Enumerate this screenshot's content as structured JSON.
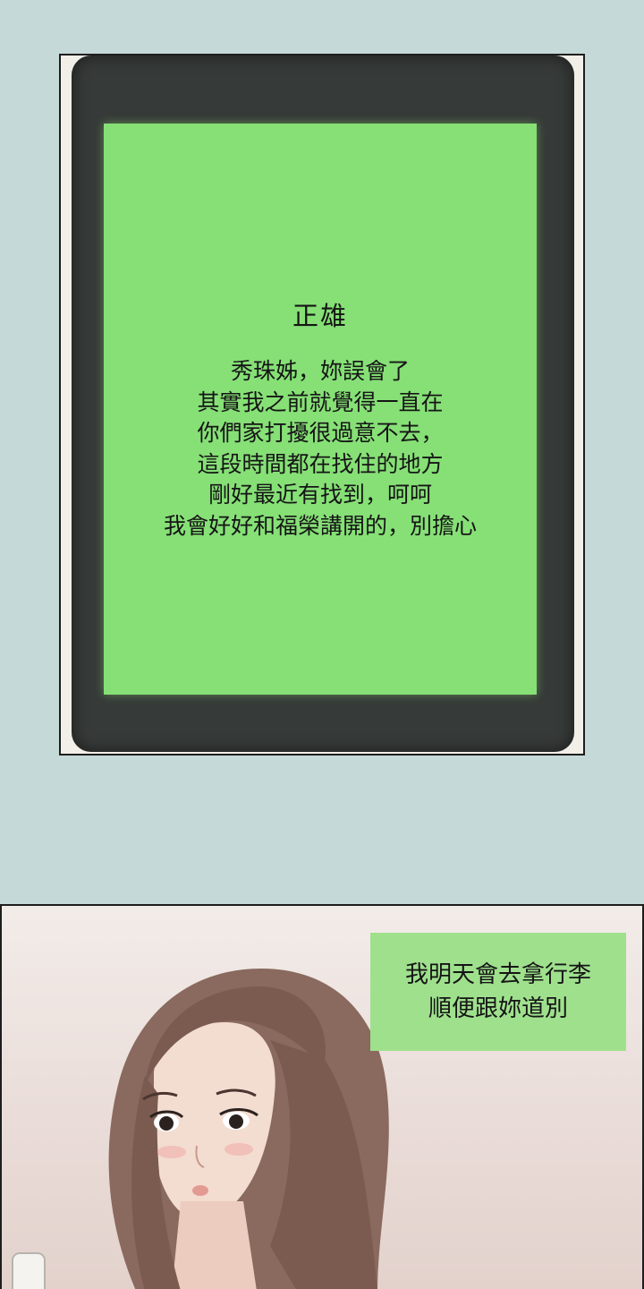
{
  "panel1": {
    "sender": "正雄",
    "message_lines": [
      "秀珠姊，妳誤會了",
      "其實我之前就覺得一直在",
      "你們家打擾很過意不去，",
      "這段時間都在找住的地方",
      "剛好最近有找到，呵呵",
      "我會好好和福榮講開的，別擔心"
    ],
    "screen_color": "#86e076",
    "phone_color": "#363a38"
  },
  "panel2": {
    "bubble_lines": [
      "我明天會去拿行李",
      "順便跟妳道別"
    ],
    "bubble_color": "#9fe08d"
  }
}
